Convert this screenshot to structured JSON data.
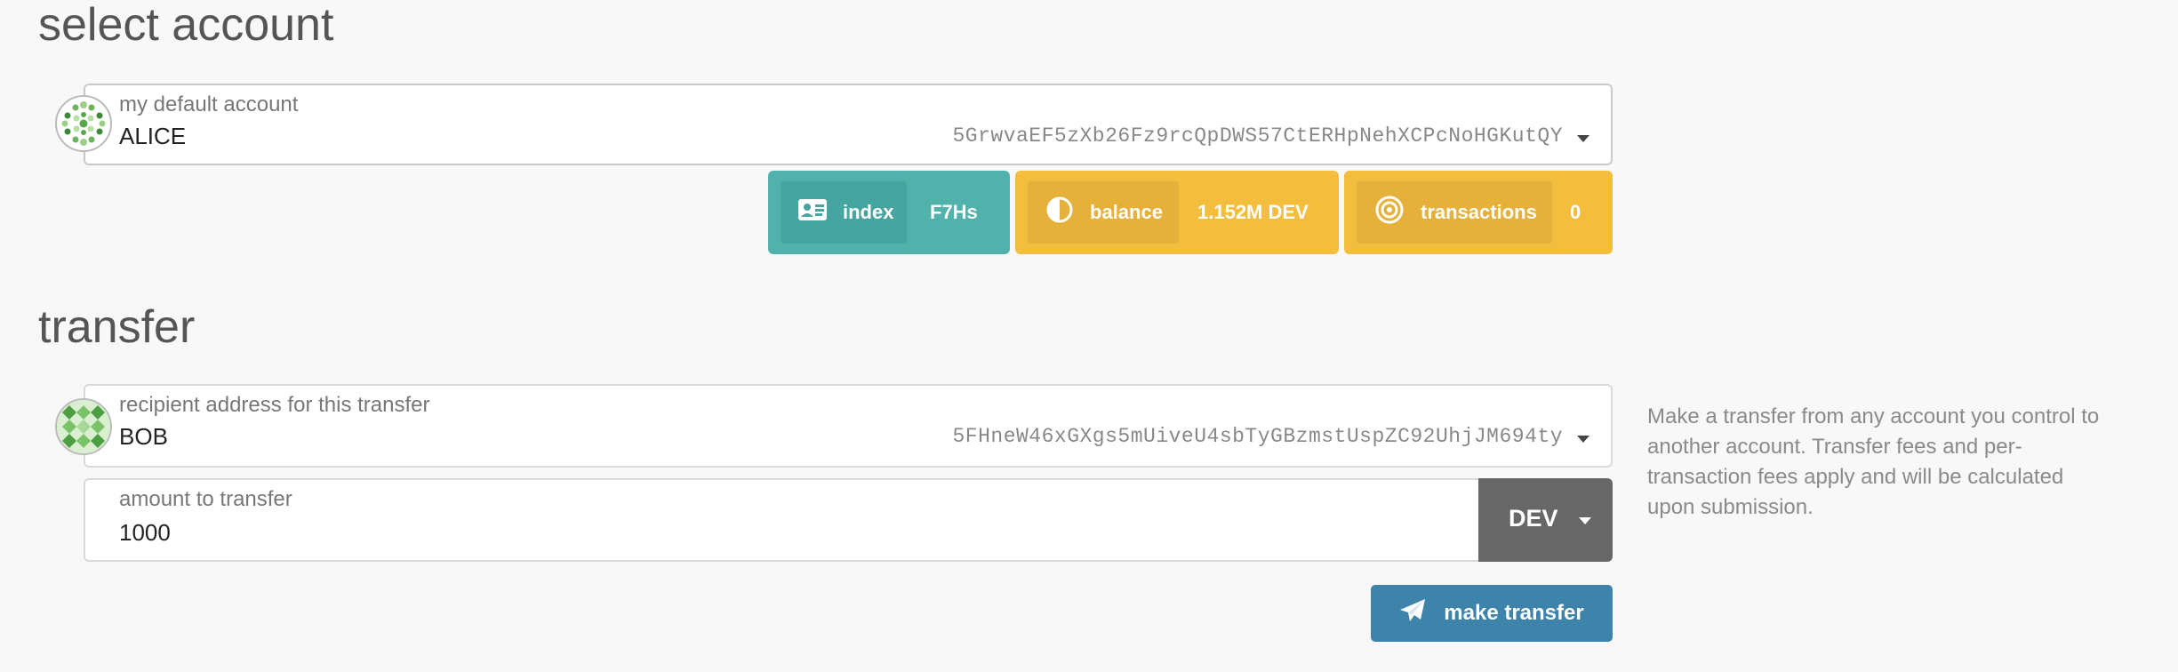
{
  "select_account": {
    "title": "select account",
    "label": "my default account",
    "name": "ALICE",
    "address": "5GrwvaEF5zXb26Fz9rcQpDWS57CtERHpNehXCPcNoHGKutQY"
  },
  "stats": {
    "index": {
      "label": "index",
      "value": "F7Hs",
      "icon": "id-card-icon"
    },
    "balance": {
      "label": "balance",
      "value": "1.152M DEV",
      "icon": "adjust-icon"
    },
    "transactions": {
      "label": "transactions",
      "value": "0",
      "icon": "bullseye-icon"
    }
  },
  "transfer": {
    "title": "transfer",
    "recipient_label": "recipient address for this transfer",
    "recipient_name": "BOB",
    "recipient_address": "5FHneW46xGXgs5mUiveU4sbTyGBzmstUspZC92UhjJM694ty",
    "amount_label": "amount to transfer",
    "amount_value": "1000",
    "unit": "DEV",
    "help": "Make a transfer from any account you control to another account. Transfer fees and per-transaction fees apply and will be calculated upon submission.",
    "button_label": "make transfer"
  },
  "colors": {
    "teal": "#50b2ab",
    "yellow": "#f3be3e",
    "button_blue": "#3d83aa",
    "unit_gray": "#676767"
  }
}
